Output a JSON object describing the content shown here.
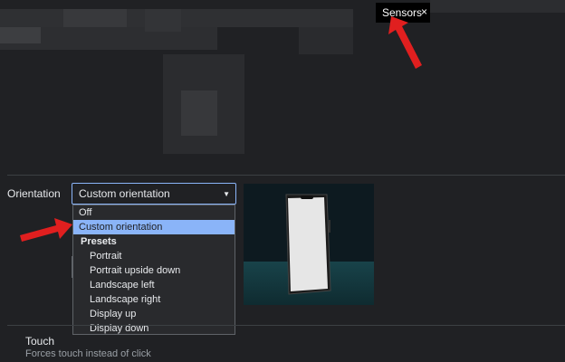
{
  "tab": {
    "label": "Sensors",
    "close_glyph": "×"
  },
  "orientation": {
    "label": "Orientation",
    "selected": "Custom orientation",
    "caret": "▼",
    "options": {
      "off": "Off",
      "custom": "Custom orientation",
      "group": "Presets",
      "presets": [
        "Portrait",
        "Portrait upside down",
        "Landscape left",
        "Landscape right",
        "Display up",
        "Display down"
      ]
    }
  },
  "touch": {
    "title": "Touch",
    "description": "Forces touch instead of click"
  },
  "colors": {
    "background": "#202124",
    "accent": "#8ab4f8",
    "annotation_arrow": "#e01f1f"
  }
}
